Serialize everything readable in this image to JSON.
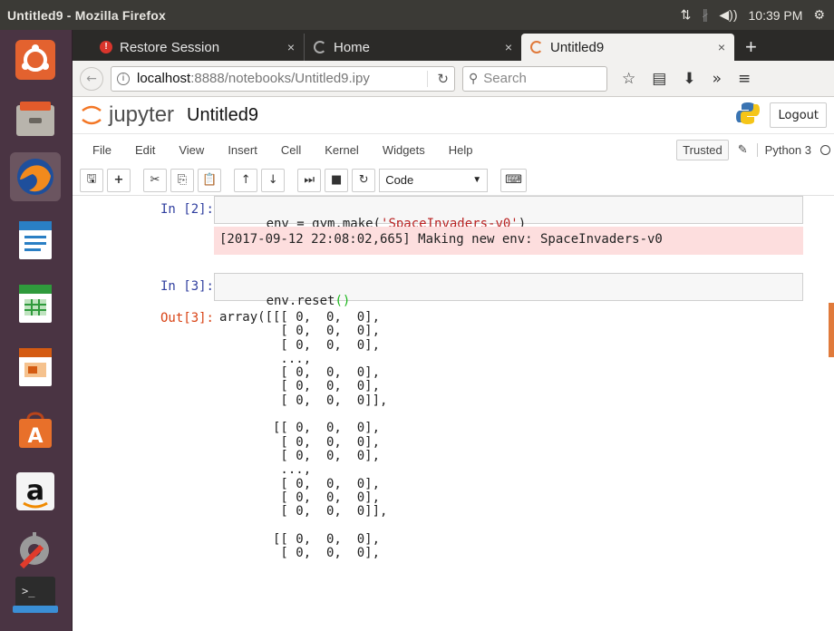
{
  "window": {
    "title": "Untitled9 - Mozilla Firefox"
  },
  "indicators": {
    "time": "10:39 PM",
    "network": "⇅",
    "bluetooth": "∦",
    "volume": "◀))",
    "settings": "⚙"
  },
  "launcher": {
    "items": [
      "ubuntu-dash",
      "files",
      "firefox",
      "writer",
      "calc",
      "impress",
      "software-center",
      "amazon",
      "system-settings",
      "terminal"
    ]
  },
  "tabs": [
    {
      "label": "Restore Session",
      "close": "×"
    },
    {
      "label": "Home",
      "close": "×"
    },
    {
      "label": "Untitled9",
      "close": "×"
    }
  ],
  "newtab": "+",
  "navbar": {
    "url_host": "localhost",
    "url_path": ":8888/notebooks/Untitled9.ipy",
    "search_placeholder": "Search"
  },
  "jupyter": {
    "brand": "jupyter",
    "notebook_name": "Untitled9",
    "logout": "Logout",
    "menu": [
      "File",
      "Edit",
      "View",
      "Insert",
      "Cell",
      "Kernel",
      "Widgets",
      "Help"
    ],
    "trusted": "Trusted",
    "kernel": "Python 3",
    "cell_type": "Code"
  },
  "cells": {
    "in2_prompt": "In [2]:",
    "in2_code_pre": "env = gym.make(",
    "in2_code_str": "'SpaceInvaders-v0'",
    "in2_code_post": ")",
    "in2_stderr": "[2017-09-12 22:08:02,665] Making new env: SpaceInvaders-v0",
    "in3_prompt": "In [3]:",
    "in3_code_pre": "env.reset",
    "in3_code_paren": "()",
    "out3_prompt": "Out[3]:",
    "out3_text": "array([[[ 0,  0,  0],\n        [ 0,  0,  0],\n        [ 0,  0,  0],\n        ...,\n        [ 0,  0,  0],\n        [ 0,  0,  0],\n        [ 0,  0,  0]],\n\n       [[ 0,  0,  0],\n        [ 0,  0,  0],\n        [ 0,  0,  0],\n        ...,\n        [ 0,  0,  0],\n        [ 0,  0,  0],\n        [ 0,  0,  0]],\n\n       [[ 0,  0,  0],\n        [ 0,  0,  0],"
  }
}
